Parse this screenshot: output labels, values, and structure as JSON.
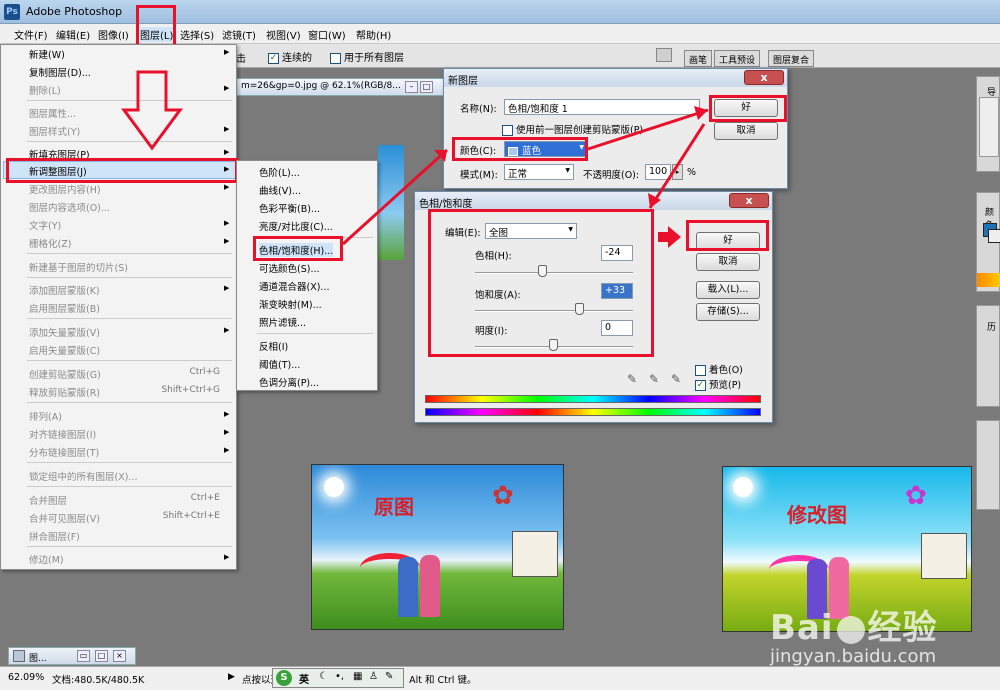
{
  "app": {
    "title": "Adobe Photoshop",
    "icon": "ps-logo-icon"
  },
  "menubar": {
    "items": [
      "文件(F)",
      "编辑(E)",
      "图像(I)",
      "图层(L)",
      "选择(S)",
      "滤镜(T)",
      "视图(V)",
      "窗口(W)",
      "帮助(H)"
    ]
  },
  "options": {
    "fragment": "击",
    "contiguous": "连续的",
    "all_layers": "用于所有图层",
    "contiguous_checked": "✓"
  },
  "palette_tabs": [
    "画笔",
    "工具预设",
    "图层复合"
  ],
  "doc": {
    "title": "m=26&gp=0.jpg @ 62.1%(RGB/8..."
  },
  "layer_menu": {
    "items": [
      {
        "label": "新建(W)",
        "arrow": true,
        "enabled": true
      },
      {
        "label": "复制图层(D)...",
        "enabled": true
      },
      {
        "label": "删除(L)",
        "arrow": true,
        "enabled": false
      },
      {
        "label": "图层属性...",
        "enabled": false
      },
      {
        "label": "图层样式(Y)",
        "arrow": true,
        "enabled": false
      },
      {
        "label": "新填充图层(P)",
        "arrow": true,
        "enabled": true
      },
      {
        "label": "新调整图层(J)",
        "arrow": true,
        "enabled": true,
        "highlighted": true
      },
      {
        "label": "更改图层内容(H)",
        "arrow": true,
        "enabled": false
      },
      {
        "label": "图层内容选项(O)...",
        "enabled": false
      },
      {
        "label": "文字(Y)",
        "arrow": true,
        "enabled": false
      },
      {
        "label": "栅格化(Z)",
        "arrow": true,
        "enabled": false
      },
      {
        "label": "新建基于图层的切片(S)",
        "enabled": false
      },
      {
        "label": "添加图层蒙版(K)",
        "arrow": true,
        "enabled": false
      },
      {
        "label": "启用图层蒙版(B)",
        "enabled": false
      },
      {
        "label": "添加矢量蒙版(V)",
        "arrow": true,
        "enabled": false
      },
      {
        "label": "启用矢量蒙版(C)",
        "enabled": false
      },
      {
        "label": "创建剪贴蒙版(G)",
        "shortcut": "Ctrl+G",
        "enabled": false
      },
      {
        "label": "释放剪贴蒙版(R)",
        "shortcut": "Shift+Ctrl+G",
        "enabled": false
      },
      {
        "label": "排列(A)",
        "arrow": true,
        "enabled": false
      },
      {
        "label": "对齐链接图层(I)",
        "arrow": true,
        "enabled": false
      },
      {
        "label": "分布链接图层(T)",
        "arrow": true,
        "enabled": false
      },
      {
        "label": "锁定组中的所有图层(X)...",
        "enabled": false
      },
      {
        "label": "合并图层",
        "shortcut": "Ctrl+E",
        "enabled": false
      },
      {
        "label": "合并可见图层(V)",
        "shortcut": "Shift+Ctrl+E",
        "enabled": false
      },
      {
        "label": "拼合图层(F)",
        "enabled": false
      },
      {
        "label": "修边(M)",
        "arrow": true,
        "enabled": false
      }
    ]
  },
  "adjust_submenu": {
    "items": [
      "色阶(L)...",
      "曲线(V)...",
      "色彩平衡(B)...",
      "亮度/对比度(C)...",
      "色相/饱和度(H)...",
      "可选颜色(S)...",
      "通道混合器(X)...",
      "渐变映射(M)...",
      "照片滤镜...",
      "反相(I)",
      "阈值(T)...",
      "色调分离(P)..."
    ]
  },
  "new_layer_dialog": {
    "title": "新图层",
    "name_label": "名称(N):",
    "name_value": "色相/饱和度 1",
    "clip_label": "使用前一图层创建剪贴蒙版(P)",
    "color_label": "颜色(C):",
    "color_value": "蓝色",
    "mode_label": "模式(M):",
    "mode_value": "正常",
    "opacity_label": "不透明度(O):",
    "opacity_value": "100",
    "opacity_unit": "%",
    "ok": "好",
    "cancel": "取消",
    "close": "x"
  },
  "hue_dialog": {
    "title": "色相/饱和度",
    "edit_label": "编辑(E):",
    "edit_value": "全图",
    "hue_label": "色相(H):",
    "hue_value": "-24",
    "sat_label": "饱和度(A):",
    "sat_value": "+33",
    "light_label": "明度(I):",
    "light_value": "0",
    "ok": "好",
    "cancel": "取消",
    "load": "载入(L)...",
    "save": "存储(S)...",
    "colorize_label": "着色(O)",
    "preview_label": "预览(P)",
    "preview_checked": "✓",
    "close": "x",
    "sliders": {
      "hue": -24,
      "saturation": 33,
      "lightness": 0
    }
  },
  "right_panels": {
    "navigator": "导",
    "color": "颜色",
    "history": "历"
  },
  "images": {
    "original_label": "原图",
    "modified_label": "修改图"
  },
  "status": {
    "zoom": "62.09%",
    "doc": "文档:480.5K/480.5K",
    "hint": "点按以选取要替换的颜色。使用 Shift、Alt 和 Ctrl 键。",
    "taskbar_item": "图...",
    "ime": "英"
  },
  "watermark": {
    "brand": "Bai",
    "brand2": "经验",
    "url": "jingyan.baidu.com"
  },
  "colors": {
    "highlight": "#e8102a",
    "accent": "#1c5180"
  }
}
